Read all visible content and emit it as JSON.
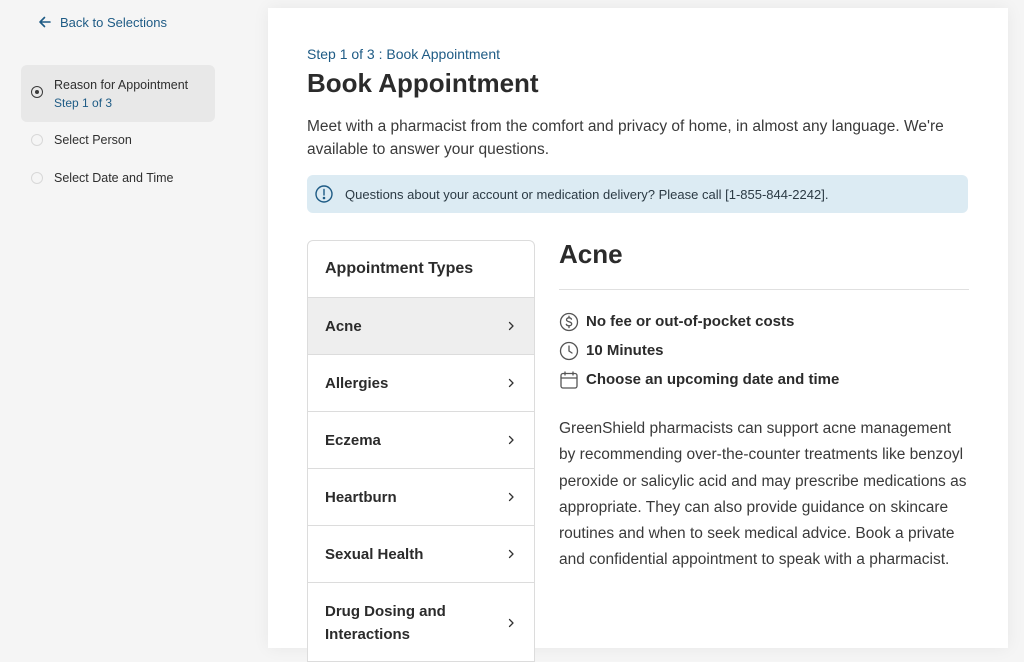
{
  "sidebar": {
    "back_label": "Back to Selections",
    "steps": [
      {
        "label": "Reason for Appointment",
        "sub": "Step 1 of 3",
        "active": true
      },
      {
        "label": "Select Person"
      },
      {
        "label": "Select Date and Time"
      }
    ]
  },
  "main": {
    "breadcrumb": "Step 1 of 3 : Book Appointment",
    "title": "Book Appointment",
    "intro": "Meet with a pharmacist from the comfort and privacy of home, in almost any language. We're available to answer your questions.",
    "banner": "Questions about your account or medication delivery? Please call [1-855-844-2242]."
  },
  "types": {
    "header": "Appointment Types",
    "items": [
      {
        "label": "Acne"
      },
      {
        "label": "Allergies"
      },
      {
        "label": "Eczema"
      },
      {
        "label": "Heartburn"
      },
      {
        "label": "Sexual Health"
      },
      {
        "label": "Drug Dosing and Interactions"
      }
    ]
  },
  "detail": {
    "title": "Acne",
    "features": [
      {
        "icon": "dollar-icon",
        "label": "No fee or out-of-pocket costs"
      },
      {
        "icon": "clock-icon",
        "label": "10 Minutes"
      },
      {
        "icon": "calendar-icon",
        "label": "Choose an upcoming date and time"
      }
    ],
    "description": "GreenShield pharmacists can support acne management by recommending over-the-counter treatments like benzoyl peroxide or salicylic acid and may prescribe medications as appropriate. They can also provide guidance on skincare routines and when to seek medical advice. Book a private and confidential appointment to speak with a pharmacist."
  },
  "colors": {
    "accent": "#1e5b85",
    "banner_bg": "#dcebf3",
    "selected_bg": "#eeeeee"
  }
}
